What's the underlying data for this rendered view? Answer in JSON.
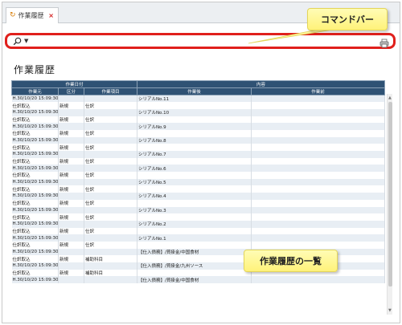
{
  "tab": {
    "label": "作業履歴",
    "close": "×"
  },
  "callouts": {
    "command_bar": "コマンドバー",
    "history_list": "作業履歴の一覧"
  },
  "page": {
    "title": "作業履歴"
  },
  "table": {
    "group_headers": {
      "date": "作業日付",
      "content": "内容"
    },
    "columns": {
      "origin": "作業元",
      "kubun": "区分",
      "item": "作業項目",
      "after": "作業後",
      "before": "作業前"
    },
    "rows": [
      {
        "a": "H.30/10/20 15:09:30",
        "b": "",
        "c": "",
        "d": "シリアルNo.11",
        "e": ""
      },
      {
        "a": "仕訳取込",
        "b": "新規",
        "c": "仕訳",
        "d": "",
        "e": ""
      },
      {
        "a": "H.30/10/20 15:09:30",
        "b": "",
        "c": "",
        "d": "シリアルNo.10",
        "e": ""
      },
      {
        "a": "仕訳取込",
        "b": "新規",
        "c": "仕訳",
        "d": "",
        "e": ""
      },
      {
        "a": "H.30/10/20 15:09:30",
        "b": "",
        "c": "",
        "d": "シリアルNo.9",
        "e": ""
      },
      {
        "a": "仕訳取込",
        "b": "新規",
        "c": "仕訳",
        "d": "",
        "e": ""
      },
      {
        "a": "H.30/10/20 15:09:30",
        "b": "",
        "c": "",
        "d": "シリアルNo.8",
        "e": ""
      },
      {
        "a": "仕訳取込",
        "b": "新規",
        "c": "仕訳",
        "d": "",
        "e": ""
      },
      {
        "a": "H.30/10/20 15:09:30",
        "b": "",
        "c": "",
        "d": "シリアルNo.7",
        "e": ""
      },
      {
        "a": "仕訳取込",
        "b": "新規",
        "c": "仕訳",
        "d": "",
        "e": ""
      },
      {
        "a": "H.30/10/20 15:09:30",
        "b": "",
        "c": "",
        "d": "シリアルNo.6",
        "e": ""
      },
      {
        "a": "仕訳取込",
        "b": "新規",
        "c": "仕訳",
        "d": "",
        "e": ""
      },
      {
        "a": "H.30/10/20 15:09:30",
        "b": "",
        "c": "",
        "d": "シリアルNo.5",
        "e": ""
      },
      {
        "a": "仕訳取込",
        "b": "新規",
        "c": "仕訳",
        "d": "",
        "e": ""
      },
      {
        "a": "H.30/10/20 15:09:30",
        "b": "",
        "c": "",
        "d": "シリアルNo.4",
        "e": ""
      },
      {
        "a": "仕訳取込",
        "b": "新規",
        "c": "仕訳",
        "d": "",
        "e": ""
      },
      {
        "a": "H.30/10/20 15:09:30",
        "b": "",
        "c": "",
        "d": "シリアルNo.3",
        "e": ""
      },
      {
        "a": "仕訳取込",
        "b": "新規",
        "c": "仕訳",
        "d": "",
        "e": ""
      },
      {
        "a": "H.30/10/20 15:09:30",
        "b": "",
        "c": "",
        "d": "シリアルNo.2",
        "e": ""
      },
      {
        "a": "仕訳取込",
        "b": "新規",
        "c": "仕訳",
        "d": "",
        "e": ""
      },
      {
        "a": "H.30/10/20 15:09:30",
        "b": "",
        "c": "",
        "d": "シリアルNo.1",
        "e": ""
      },
      {
        "a": "仕訳取込",
        "b": "新規",
        "c": "仕訳",
        "d": "",
        "e": ""
      },
      {
        "a": "H.30/10/20 15:09:30",
        "b": "",
        "c": "",
        "d": "【仕入債務】/買掛金/中国食材",
        "e": ""
      },
      {
        "a": "仕訳取込",
        "b": "新規",
        "c": "補助科目",
        "d": "",
        "e": ""
      },
      {
        "a": "H.30/10/20 15:09:30",
        "b": "",
        "c": "",
        "d": "【仕入債務】/買掛金/九州ソース",
        "e": ""
      },
      {
        "a": "仕訳取込",
        "b": "新規",
        "c": "補助科目",
        "d": "",
        "e": ""
      },
      {
        "a": "H.30/10/20 15:09:30",
        "b": "",
        "c": "",
        "d": "【仕入債務】/買掛金/中国食材",
        "e": ""
      }
    ]
  },
  "icons": {
    "tab": "refresh-icon",
    "search": "search-icon",
    "dropdown": "chevron-down-icon",
    "print": "printer-icon"
  },
  "colors": {
    "header_bg": "#2f5274",
    "row_alt": "#e8eef4",
    "cmdbar_border": "#e0201c",
    "callout_bg": "#fff27a"
  }
}
